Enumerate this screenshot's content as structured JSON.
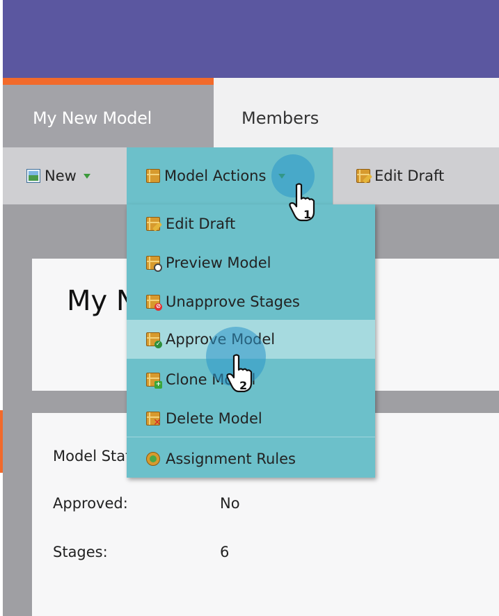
{
  "tabs": [
    {
      "label": "My New Model"
    },
    {
      "label": "Members"
    }
  ],
  "toolbar": {
    "new_label": "New",
    "model_actions_label": "Model Actions",
    "edit_draft_label": "Edit Draft"
  },
  "menu": {
    "items": [
      {
        "label": "Edit Draft",
        "icon": "edit-draft-icon"
      },
      {
        "label": "Preview Model",
        "icon": "preview-model-icon"
      },
      {
        "label": "Unapprove Stages",
        "icon": "unapprove-stages-icon"
      },
      {
        "label": "Approve Model",
        "icon": "approve-model-icon"
      },
      {
        "label": "Clone Model",
        "icon": "clone-model-icon"
      },
      {
        "label": "Delete Model",
        "icon": "delete-model-icon"
      },
      {
        "label": "Assignment Rules",
        "icon": "assignment-rules-icon"
      }
    ]
  },
  "page": {
    "title": "My New Model"
  },
  "info": {
    "model_status_label": "Model Status:",
    "approved_label": "Approved:",
    "approved_value": "No",
    "stages_label": "Stages:",
    "stages_value": "6"
  },
  "callouts": {
    "step1": "1",
    "step2": "2"
  },
  "colors": {
    "header": "#5b57a0",
    "tab_accent": "#f26a2b",
    "menu_bg": "#6cc0ca",
    "menu_highlight": "#a6dadf"
  }
}
